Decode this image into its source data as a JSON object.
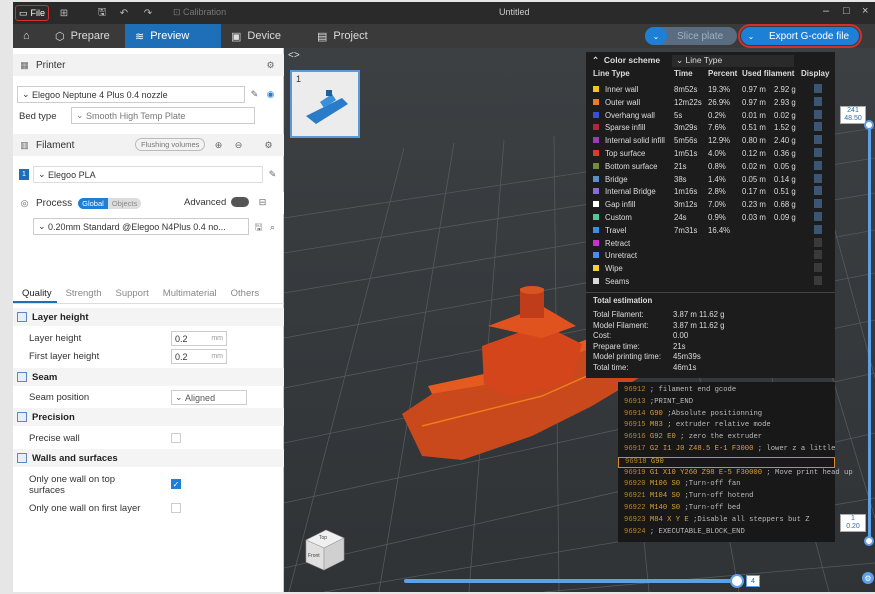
{
  "titlebar": {
    "file_label": "File",
    "calibration_label": "Calibration",
    "window_title": "Untitled",
    "minimize": "–",
    "maximize": "□",
    "close": "×"
  },
  "tabs": {
    "prepare": "Prepare",
    "preview": "Preview",
    "device": "Device",
    "project": "Project"
  },
  "actions": {
    "slice_plate": "Slice plate",
    "export_gcode": "Export G-code file"
  },
  "printer": {
    "section_title": "Printer",
    "printer_name": "Elegoo Neptune 4 Plus 0.4 nozzle",
    "bed_type_label": "Bed type",
    "bed_type_value": "Smooth High Temp Plate"
  },
  "filament": {
    "section_title": "Filament",
    "flushing_volumes": "Flushing volumes",
    "slot_number": "1",
    "filament_name": "Elegoo PLA"
  },
  "process": {
    "section_title": "Process",
    "toggle_global": "Global",
    "toggle_objects": "Objects",
    "advanced_label": "Advanced",
    "profile": "0.20mm Standard @Elegoo N4Plus 0.4 no..."
  },
  "settings_tabs": [
    "Quality",
    "Strength",
    "Support",
    "Multimaterial",
    "Others"
  ],
  "quality": {
    "layer_height_group": "Layer height",
    "layer_height_label": "Layer height",
    "layer_height_value": "0.2",
    "first_layer_height_label": "First layer height",
    "first_layer_height_value": "0.2",
    "unit_mm": "mm",
    "seam_group": "Seam",
    "seam_position_label": "Seam position",
    "seam_position_value": "Aligned",
    "precision_group": "Precision",
    "precise_wall_label": "Precise wall",
    "walls_group": "Walls and surfaces",
    "one_wall_top_label": "Only one wall on top surfaces",
    "one_wall_first_label": "Only one wall on first layer",
    "one_wall_top_checked": true,
    "one_wall_first_checked": false,
    "precise_wall_checked": false
  },
  "plate": {
    "number": "1"
  },
  "color_scheme": {
    "title": "Color scheme",
    "view_type": "Line Type",
    "columns": [
      "Line Type",
      "Time",
      "Percent",
      "Used filament",
      "Display"
    ],
    "rows": [
      {
        "name": "Inner wall",
        "color": "#f5c518",
        "time": "8m52s",
        "percent": "19.3%",
        "filament": "0.97 m",
        "weight": "2.92 g"
      },
      {
        "name": "Outer wall",
        "color": "#f07c1b",
        "time": "12m22s",
        "percent": "26.9%",
        "filament": "0.97 m",
        "weight": "2.93 g"
      },
      {
        "name": "Overhang wall",
        "color": "#3a4fd1",
        "time": "5s",
        "percent": "0.2%",
        "filament": "0.01 m",
        "weight": "0.02 g"
      },
      {
        "name": "Sparse infill",
        "color": "#b0263c",
        "time": "3m29s",
        "percent": "7.6%",
        "filament": "0.51 m",
        "weight": "1.52 g"
      },
      {
        "name": "Internal solid infill",
        "color": "#9b3bb6",
        "time": "5m56s",
        "percent": "12.9%",
        "filament": "0.80 m",
        "weight": "2.40 g"
      },
      {
        "name": "Top surface",
        "color": "#e0392c",
        "time": "1m51s",
        "percent": "4.0%",
        "filament": "0.12 m",
        "weight": "0.36 g"
      },
      {
        "name": "Bottom surface",
        "color": "#6e8e3a",
        "time": "21s",
        "percent": "0.8%",
        "filament": "0.02 m",
        "weight": "0.05 g"
      },
      {
        "name": "Bridge",
        "color": "#5c8fc7",
        "time": "38s",
        "percent": "1.4%",
        "filament": "0.05 m",
        "weight": "0.14 g"
      },
      {
        "name": "Internal Bridge",
        "color": "#8a6bd6",
        "time": "1m16s",
        "percent": "2.8%",
        "filament": "0.17 m",
        "weight": "0.51 g"
      },
      {
        "name": "Gap infill",
        "color": "#ffffff",
        "time": "3m12s",
        "percent": "7.0%",
        "filament": "0.23 m",
        "weight": "0.68 g"
      },
      {
        "name": "Custom",
        "color": "#4fc99a",
        "time": "24s",
        "percent": "0.9%",
        "filament": "0.03 m",
        "weight": "0.09 g"
      },
      {
        "name": "Travel",
        "color": "#3a8ee6",
        "time": "7m31s",
        "percent": "16.4%",
        "filament": "",
        "weight": ""
      },
      {
        "name": "Retract",
        "color": "#c236c9",
        "time": "",
        "percent": "",
        "filament": "",
        "weight": ""
      },
      {
        "name": "Unretract",
        "color": "#4a8cf0",
        "time": "",
        "percent": "",
        "filament": "",
        "weight": ""
      },
      {
        "name": "Wipe",
        "color": "#f2d23a",
        "time": "",
        "percent": "",
        "filament": "",
        "weight": ""
      },
      {
        "name": "Seams",
        "color": "#d9d9d9",
        "time": "",
        "percent": "",
        "filament": "",
        "weight": ""
      }
    ],
    "total_title": "Total estimation",
    "totals": [
      {
        "label": "Total Filament:",
        "value": "3.87 m    11.62 g"
      },
      {
        "label": "Model Filament:",
        "value": "3.87 m    11.62 g"
      },
      {
        "label": "Cost:",
        "value": "0.00"
      },
      {
        "label": "Prepare time:",
        "value": "21s"
      },
      {
        "label": "Model printing time:",
        "value": "45m39s"
      },
      {
        "label": "Total time:",
        "value": "46m1s"
      }
    ]
  },
  "gcode": [
    {
      "line": "96912",
      "cmd": "",
      "text": "; filament end gcode"
    },
    {
      "line": "96913",
      "cmd": "",
      "text": ";PRINT_END"
    },
    {
      "line": "96914",
      "cmd": "G90",
      "text": ";Absolute positionning"
    },
    {
      "line": "96915",
      "cmd": "M83",
      "text": "; extruder relative mode"
    },
    {
      "line": "96916",
      "cmd": "G92 E0",
      "text": "; zero the extruder"
    },
    {
      "line": "96917",
      "cmd": "G2 I1 J0 Z48.5 E-1 F3000",
      "text": "; lower z a little"
    },
    {
      "line": "96918",
      "cmd": "G90",
      "text": ""
    },
    {
      "line": "96919",
      "cmd": "G1 X10 Y260 Z98 E-5 F30000",
      "text": "; Move print head up"
    },
    {
      "line": "96920",
      "cmd": "M106 S0",
      "text": ";Turn-off fan"
    },
    {
      "line": "96921",
      "cmd": "M104 S0",
      "text": ";Turn-off hotend"
    },
    {
      "line": "96922",
      "cmd": "M140 S0",
      "text": ";Turn-off bed"
    },
    {
      "line": "96923",
      "cmd": "M84 X Y E",
      "text": ";Disable all steppers but Z"
    },
    {
      "line": "96924",
      "cmd": "",
      "text": "; EXECUTABLE_BLOCK_END"
    }
  ],
  "layer_slider": {
    "top_layer": "241",
    "top_height": "48.50",
    "bottom_layer": "1",
    "bottom_height": "0.20"
  },
  "move_slider": {
    "value_label": "4"
  },
  "navcube": {
    "top": "Top",
    "front": "Front"
  }
}
